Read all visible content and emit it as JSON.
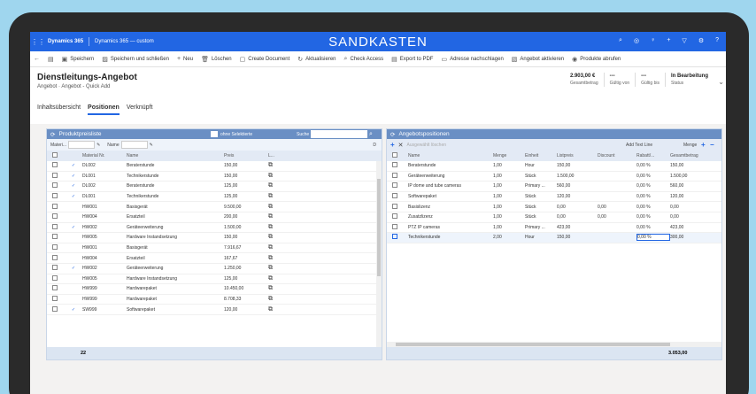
{
  "app": {
    "name": "Dynamics 365",
    "area": "Dynamics 365 — custom",
    "environment": "SANDKASTEN"
  },
  "commands": [
    {
      "icon": "save-icon",
      "label": "Speichern"
    },
    {
      "icon": "save-close-icon",
      "label": "Speichern und schließen"
    },
    {
      "icon": "plus-icon",
      "label": "Neu"
    },
    {
      "icon": "delete-icon",
      "label": "Löschen"
    },
    {
      "icon": "document-icon",
      "label": "Create Document"
    },
    {
      "icon": "refresh-icon",
      "label": "Aktualisieren"
    },
    {
      "icon": "search-icon",
      "label": "Check Access"
    },
    {
      "icon": "pdf-icon",
      "label": "Export to PDF"
    },
    {
      "icon": "lookup-icon",
      "label": "Adresse nachschlagen"
    },
    {
      "icon": "activate-icon",
      "label": "Angebot aktivieren"
    },
    {
      "icon": "products-icon",
      "label": "Produkte abrufen"
    }
  ],
  "record": {
    "title": "Dienstleitungs-Angebot",
    "subtitle": "Angebot · Angebot - Quick Add"
  },
  "header_fields": [
    {
      "value": "2.903,00 €",
      "label": "Gesamtbetrag"
    },
    {
      "value": "---",
      "label": "Gültig von"
    },
    {
      "value": "---",
      "label": "Gültig bis"
    },
    {
      "value": "In Bearbeitung",
      "label": "Status"
    }
  ],
  "tabs": [
    "Inhaltsübersicht",
    "Positionen",
    "Verknüpft"
  ],
  "left": {
    "title": "Produktpreisliste",
    "toggle_label": "ohne Selektierte",
    "search_label": "Suche",
    "filter_labels": [
      "Materi...",
      "Name"
    ],
    "filter_right": "D",
    "columns": [
      "Material Nr.",
      "Name",
      "Preis",
      "L..."
    ],
    "rows": [
      [
        "DL002",
        "Beraterstunde",
        "150,00",
        true
      ],
      [
        "DL001",
        "Technikerstunde",
        "150,00",
        true
      ],
      [
        "DL002",
        "Beraterstunde",
        "125,00",
        true
      ],
      [
        "DL001",
        "Technikerstunde",
        "125,00",
        true
      ],
      [
        "HW001",
        "Basisgerät",
        "9.500,00",
        false
      ],
      [
        "HW004",
        "Ersatzteil",
        "200,00",
        false
      ],
      [
        "HW002",
        "Geräteerweiterung",
        "1.500,00",
        true
      ],
      [
        "HW005",
        "Hardware Instandsetzung",
        "150,00",
        false
      ],
      [
        "HW001",
        "Basisgerät",
        "7.916,67",
        false
      ],
      [
        "HW004",
        "Ersatzteil",
        "167,67",
        false
      ],
      [
        "HW002",
        "Geräteerweiterung",
        "1.250,00",
        true
      ],
      [
        "HW005",
        "Hardware Instandsetzung",
        "125,00",
        false
      ],
      [
        "HW999",
        "Hardwarepaket",
        "10.450,00",
        false
      ],
      [
        "HW999",
        "Hardwarepaket",
        "8.708,33",
        false
      ],
      [
        "SW999",
        "Softwarepaket",
        "120,00",
        true
      ]
    ],
    "footer_count": "22"
  },
  "right": {
    "title": "Angebotspositionen",
    "delete_label": "Ausgewählt löschen",
    "add_text_line": "Add Text Line",
    "menge_label": "Menge",
    "columns": [
      "Name",
      "Menge",
      "Einheit",
      "Listpreis",
      "Discount",
      "Rabatt/...",
      "Gesamtbetrag"
    ],
    "rows": [
      [
        "Beraterstunde",
        "1,00",
        "Hour",
        "150,00",
        "",
        "0,00 %",
        "150,00"
      ],
      [
        "Geräteerweiterung",
        "1,00",
        "Stück",
        "1.500,00",
        "",
        "0,00 %",
        "1.500,00"
      ],
      [
        "IP dome and tube cameras",
        "1,00",
        "Primary ...",
        "560,00",
        "",
        "0,00 %",
        "560,00"
      ],
      [
        "Softwarepaket",
        "1,00",
        "Stück",
        "120,00",
        "",
        "0,00 %",
        "120,00"
      ],
      [
        "Basislizenz",
        "1,00",
        "Stück",
        "0,00",
        "0,00",
        "0,00 %",
        "0,00"
      ],
      [
        "Zusatzlizenz",
        "1,00",
        "Stück",
        "0,00",
        "0,00",
        "0,00 %",
        "0,00"
      ],
      [
        "PTZ IP cameras",
        "1,00",
        "Primary ...",
        "423,00",
        "",
        "0,00 %",
        "423,00"
      ],
      [
        "Technikerstunde",
        "2,00",
        "Hour",
        "150,00",
        "",
        "0,00 %",
        "300,00"
      ]
    ],
    "total": "3.053,00"
  }
}
